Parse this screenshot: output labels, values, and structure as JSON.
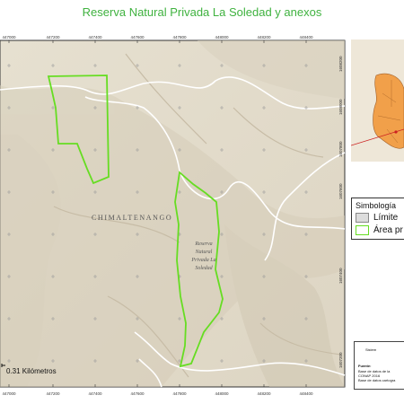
{
  "title": "Reserva Natural Privada La Soledad y anexos",
  "map": {
    "region_label": "CHIMALTENANGO",
    "reserve_label_lines": [
      "Reserva",
      "Natural",
      "Privada La",
      "Soledad"
    ],
    "scale_label": "0.31 Kilómetros",
    "x_ticks": [
      "447000",
      "447200",
      "447400",
      "447600",
      "447800",
      "448000",
      "448200",
      "448400"
    ],
    "y_ticks": [
      "1608200",
      "1608000",
      "1607800",
      "1607600",
      "1607400",
      "1607200"
    ],
    "polygon_color": "#66dd22",
    "background_color": "#e3dccc"
  },
  "legend": {
    "title": "Simbología",
    "items": [
      {
        "label": "Límite",
        "color": "#dddddd"
      },
      {
        "label": "Área pr",
        "color": "#66dd22"
      }
    ]
  },
  "info": {
    "title": "Sistem",
    "source_label": "Fuente:",
    "source_lines": [
      "Base de datos de la",
      "CONAP 2016",
      "Base de datos cartogra"
    ]
  }
}
